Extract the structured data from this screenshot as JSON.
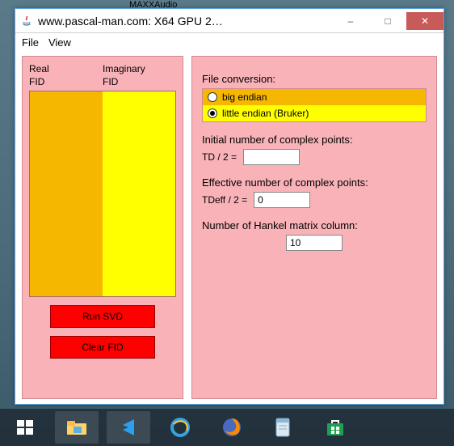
{
  "desktop": {
    "background_app_hint": "MAXXAudio"
  },
  "window": {
    "title": "www.pascal-man.com: X64 GPU 2…",
    "icon": "java-icon",
    "controls": {
      "minimize": "–",
      "maximize": "□",
      "close": "✕"
    }
  },
  "menubar": {
    "file": "File",
    "view": "View"
  },
  "left": {
    "real_header_1": "Real",
    "real_header_2": "FID",
    "imag_header_1": "Imaginary",
    "imag_header_2": "FID",
    "run_svd": "Run SVD",
    "clear_fid": "Clear FID"
  },
  "right": {
    "file_conversion_label": "File conversion:",
    "big_endian_label": "big endian",
    "little_endian_label": "little endian (Bruker)",
    "endian_selected": "little",
    "td_label_line": "Initial number of complex points:",
    "td_prefix": "TD / 2 =",
    "td_value": "",
    "tdeff_label_line": "Effective number of complex points:",
    "tdeff_prefix": "TDeff / 2 =",
    "tdeff_value": "0",
    "hankel_label": "Number of Hankel matrix column:",
    "hankel_value": "10"
  },
  "taskbar": {
    "items": [
      "start",
      "file-explorer",
      "vscode",
      "ie",
      "firefox",
      "notepad",
      "store"
    ]
  }
}
